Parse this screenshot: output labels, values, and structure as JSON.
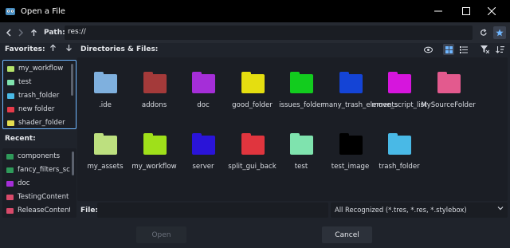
{
  "window": {
    "title": "Open a File"
  },
  "pathbar": {
    "label": "Path:",
    "value": "res://"
  },
  "favorites": {
    "header": "Favorites:",
    "items": [
      {
        "label": "my_workflow",
        "color": "#b5e36a"
      },
      {
        "label": "test",
        "color": "#7fe3ae"
      },
      {
        "label": "trash_folder",
        "color": "#49b9e6"
      },
      {
        "label": "new folder",
        "color": "#e63b4a"
      },
      {
        "label": "shader_folder",
        "color": "#e5de4f"
      }
    ]
  },
  "recent": {
    "header": "Recent:",
    "items": [
      {
        "label": "components",
        "color": "#2f9a5a"
      },
      {
        "label": "fancy_filters_sc...",
        "color": "#2f9a5a"
      },
      {
        "label": "doc",
        "color": "#a52ed8"
      },
      {
        "label": "TestingContent",
        "color": "#d84a6a"
      },
      {
        "label": "ReleaseContent",
        "color": "#d84a6a"
      }
    ]
  },
  "files": {
    "header": "Directories & Files:",
    "items": [
      {
        "label": ".ide",
        "color": "#7fb0de"
      },
      {
        "label": "addons",
        "color": "#a43a3a"
      },
      {
        "label": "doc",
        "color": "#a52ed8"
      },
      {
        "label": "good_folder",
        "color": "#e5de10"
      },
      {
        "label": "issues_folder",
        "color": "#12cc1e"
      },
      {
        "label": "many_trash_elements",
        "color": "#1444d6"
      },
      {
        "label": "move_script_list",
        "color": "#d615dd"
      },
      {
        "label": "MySourceFolder",
        "color": "#e35a8e"
      },
      {
        "label": "my_assets",
        "color": "#bde07f"
      },
      {
        "label": "my_workflow",
        "color": "#9fe01a"
      },
      {
        "label": "server",
        "color": "#2a14d8"
      },
      {
        "label": "split_gui_back",
        "color": "#e0353e"
      },
      {
        "label": "test",
        "color": "#7fe3ae"
      },
      {
        "label": "test_image",
        "color": "#000000"
      },
      {
        "label": "trash_folder",
        "color": "#49b9e6"
      }
    ]
  },
  "bottom": {
    "file_label": "File:",
    "file_value": "",
    "filter": "All Recognized (*.tres, *.res, *.stylebox)",
    "open_label": "Open",
    "cancel_label": "Cancel"
  },
  "accent": "#6fb6ff"
}
